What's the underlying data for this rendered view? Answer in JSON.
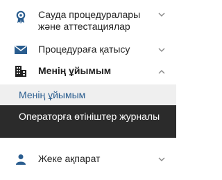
{
  "menu": {
    "items": [
      {
        "label": "Сауда процедуралары және аттестациялар",
        "icon": "award-icon",
        "expanded": false
      },
      {
        "label": "Процедураға қатысу",
        "icon": "envelope-icon",
        "expanded": false
      },
      {
        "label": "Менің ұйымым",
        "icon": "organization-icon",
        "expanded": true,
        "subitems": [
          {
            "label": "Менің ұйымым"
          },
          {
            "label": "Операторға өтініштер журналы"
          }
        ]
      },
      {
        "label": "Жеке ақпарат",
        "icon": "user-icon",
        "expanded": false
      }
    ]
  },
  "colors": {
    "icon_blue": "#2a5d8f",
    "active_bg": "#2b2b2b",
    "selected_bg": "#efefef",
    "link_blue": "#2a5d8f"
  }
}
